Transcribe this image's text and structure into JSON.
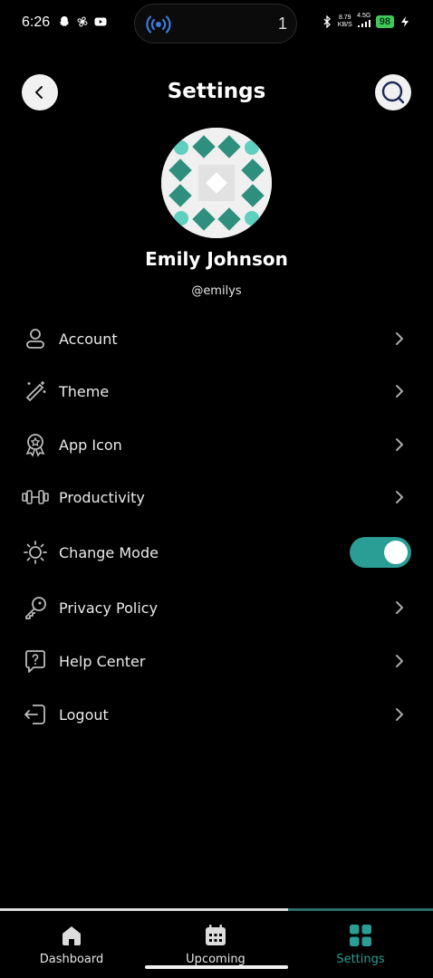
{
  "status_bar": {
    "time": "6:26",
    "net_speed_top": "8.79",
    "net_speed_bottom": "KB/S",
    "network": "4.5G",
    "battery": "98",
    "notification_count": "1"
  },
  "header": {
    "title": "Settings",
    "back_icon": "chevron-left-icon",
    "search_icon": "search-icon"
  },
  "profile": {
    "name": "Emily Johnson",
    "handle": "@emilys"
  },
  "menu": {
    "items": [
      {
        "label": "Account",
        "icon": "user-icon"
      },
      {
        "label": "Theme",
        "icon": "magic-wand-icon"
      },
      {
        "label": "App Icon",
        "icon": "award-icon"
      },
      {
        "label": "Productivity",
        "icon": "dumbbell-icon"
      },
      {
        "label": "Change Mode",
        "icon": "sun-icon",
        "toggle_on": true
      },
      {
        "label": "Privacy Policy",
        "icon": "key-icon"
      },
      {
        "label": "Help Center",
        "icon": "help-bubble-icon"
      },
      {
        "label": "Logout",
        "icon": "logout-icon"
      }
    ]
  },
  "bottom_nav": {
    "items": [
      {
        "label": "Dashboard",
        "icon": "home-icon",
        "active": false
      },
      {
        "label": "Upcoming",
        "icon": "calendar-icon",
        "active": false
      },
      {
        "label": "Settings",
        "icon": "grid-icon",
        "active": true
      }
    ]
  },
  "colors": {
    "accent": "#2a9d94",
    "background": "#000000",
    "avatar_pattern": "#2f8f7f",
    "avatar_dots": "#5fcfbf"
  }
}
